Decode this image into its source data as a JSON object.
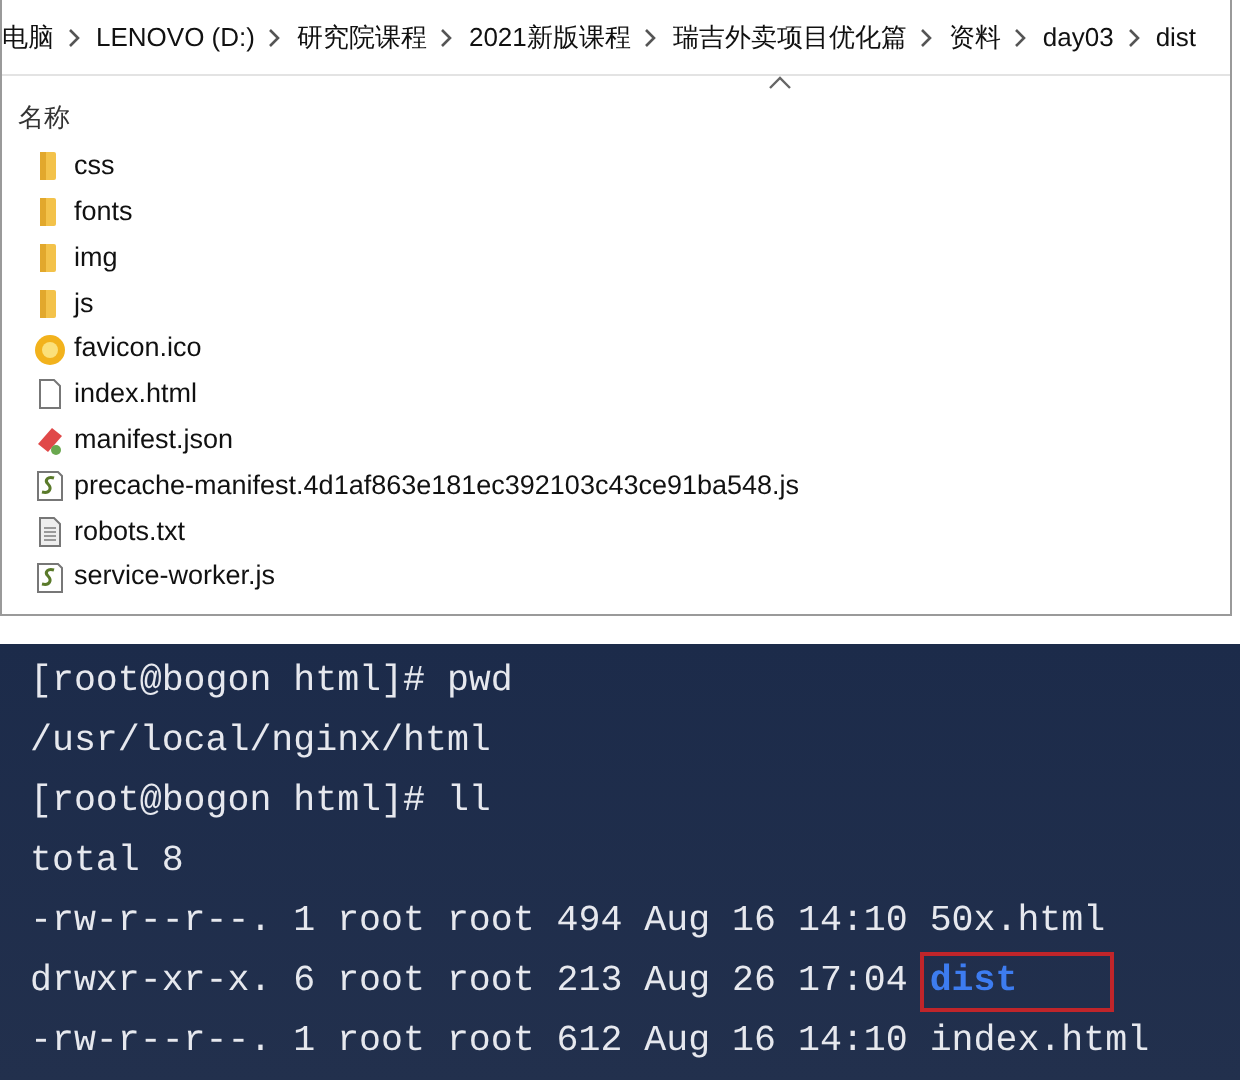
{
  "breadcrumb": [
    "电脑",
    "LENOVO (D:)",
    "研究院课程",
    "2021新版课程",
    "瑞吉外卖项目优化篇",
    "资料",
    "day03",
    "dist"
  ],
  "column_header": {
    "label": "名称",
    "sorted_ascending": true
  },
  "files": [
    {
      "name": "css",
      "kind": "folder"
    },
    {
      "name": "fonts",
      "kind": "folder"
    },
    {
      "name": "img",
      "kind": "folder"
    },
    {
      "name": "js",
      "kind": "folder"
    },
    {
      "name": "favicon.ico",
      "kind": "favicon"
    },
    {
      "name": "index.html",
      "kind": "blank"
    },
    {
      "name": "manifest.json",
      "kind": "json"
    },
    {
      "name": "precache-manifest.4d1af863e181ec392103c43ce91ba548.js",
      "kind": "script"
    },
    {
      "name": "robots.txt",
      "kind": "text"
    },
    {
      "name": "service-worker.js",
      "kind": "script"
    }
  ],
  "terminal": [
    {
      "text": "[root@bogon html]# pwd"
    },
    {
      "text": "/usr/local/nginx/html"
    },
    {
      "text": "[root@bogon html]# ll"
    },
    {
      "text": "total 8"
    },
    {
      "text": "-rw-r--r--. 1 root root 494 Aug 16 14:10",
      "entry": {
        "name": "50x.html",
        "is_directory": false,
        "highlighted": false
      }
    },
    {
      "text": "drwxr-xr-x. 6 root root 213 Aug 26 17:04",
      "entry": {
        "name": "dist",
        "is_directory": true,
        "highlighted": true
      }
    },
    {
      "text": "-rw-r--r--. 1 root root 612 Aug 16 14:10",
      "entry": {
        "name": "index.html",
        "is_directory": false,
        "highlighted": false
      }
    }
  ]
}
